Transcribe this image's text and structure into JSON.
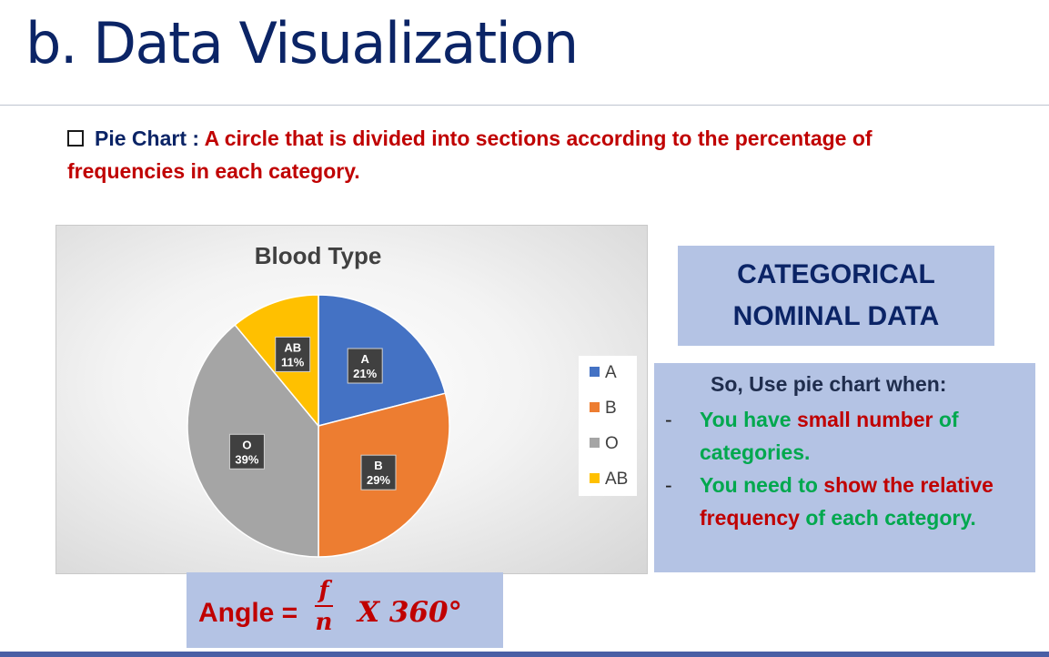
{
  "slide": {
    "title": "b. Data Visualization",
    "intro_label": "Pie Chart : ",
    "intro_text": "A circle that is divided into sections according to the percentage of frequencies in each category."
  },
  "chart_data": {
    "type": "pie",
    "title": "Blood Type",
    "categories": [
      "A",
      "B",
      "O",
      "AB"
    ],
    "values": [
      21,
      29,
      39,
      11
    ],
    "labels": [
      "21%",
      "29%",
      "39%",
      "11%"
    ],
    "colors": [
      "#4472c4",
      "#ed7d31",
      "#a5a5a5",
      "#ffc000"
    ],
    "legend_position": "right"
  },
  "categorical_box": {
    "line1": "CATEGORICAL",
    "line2": "NOMINAL DATA"
  },
  "use_box": {
    "heading": "So, Use pie chart when:",
    "bullet1": {
      "a": "You have ",
      "b": "small number",
      "c": " of categories."
    },
    "bullet2": {
      "a": "You need to ",
      "b": "show the relative frequency",
      "c": " of each category."
    }
  },
  "formula": {
    "lead": "Angle =",
    "numerator": "f",
    "denominator": "n",
    "tail": "X 360°"
  }
}
